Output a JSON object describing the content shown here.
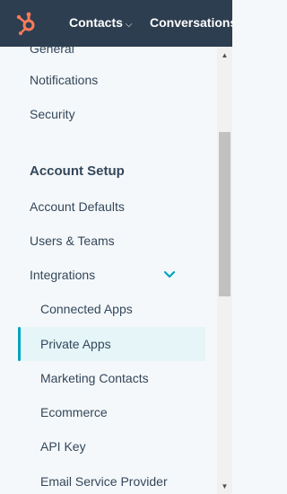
{
  "topnav": {
    "items": [
      {
        "label": "Contacts",
        "caret": "⌵"
      },
      {
        "label": "Conversations",
        "caret": "⌵"
      }
    ]
  },
  "sidebar": {
    "items": [
      {
        "label": "General",
        "level": "top"
      },
      {
        "label": "Notifications",
        "level": "top"
      },
      {
        "label": "Security",
        "level": "top"
      },
      {
        "label": "Account Setup",
        "level": "heading"
      },
      {
        "label": "Account Defaults",
        "level": "top"
      },
      {
        "label": "Users & Teams",
        "level": "top"
      },
      {
        "label": "Integrations",
        "level": "top",
        "expanded": true
      },
      {
        "label": "Connected Apps",
        "level": "sub"
      },
      {
        "label": "Private Apps",
        "level": "sub",
        "active": true
      },
      {
        "label": "Marketing Contacts",
        "level": "sub"
      },
      {
        "label": "Ecommerce",
        "level": "sub"
      },
      {
        "label": "API Key",
        "level": "sub"
      },
      {
        "label": "Email Service Provider",
        "level": "sub"
      }
    ]
  },
  "colors": {
    "topbar": "#2d3e50",
    "brand": "#ff7a59",
    "accent": "#00a4bd",
    "active_bg": "#e5f5f8",
    "text": "#33475b"
  },
  "icons": {
    "logo": "hubspot-sprocket-icon",
    "expand": "chevron-down-icon",
    "scroll_up": "scroll-up-arrow-icon",
    "scroll_down": "scroll-down-arrow-icon"
  }
}
